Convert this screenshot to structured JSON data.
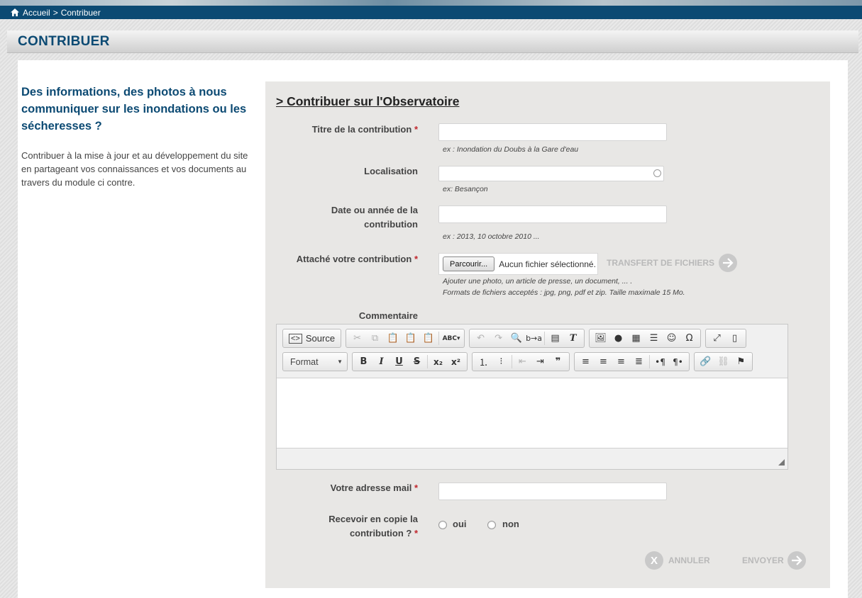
{
  "breadcrumb": {
    "home": "Accueil",
    "separator": ">",
    "current": "Contribuer"
  },
  "page": {
    "title": "CONTRIBUER"
  },
  "intro": {
    "heading": "Des informations, des photos à nous communiquer sur les inondations ou les sécheresses ?",
    "text": "Contribuer à la mise à jour et au développement du site en partageant vos connaissances et vos documents au travers du module ci contre."
  },
  "form": {
    "title": "> Contribuer sur l'Observatoire",
    "required_mark": "*",
    "titre": {
      "label": "Titre de la contribution",
      "value": "",
      "hint": "ex : Inondation du Doubs à la Gare d'eau"
    },
    "localisation": {
      "label": "Localisation",
      "value": "",
      "hint": "ex: Besançon"
    },
    "date": {
      "label": "Date ou année de la contribution",
      "value": "",
      "hint": "ex : 2013, 10 octobre 2010 ..."
    },
    "attachment": {
      "label": "Attaché votre contribution",
      "browse_label": "Parcourir...",
      "status": "Aucun fichier sélectionné.",
      "transfer_label": "TRANSFERT DE FICHIERS",
      "hint_line1": "Ajouter une photo, un article de presse, un document, ... .",
      "hint_line2": "Formats de fichiers acceptés : jpg, png, pdf et zip. Taille maximale 15 Mo."
    },
    "comment": {
      "label": "Commentaire",
      "source_label": "Source",
      "format_label": "Format",
      "spellcheck_label": "ABC"
    },
    "email": {
      "label": "Votre adresse mail",
      "value": ""
    },
    "copy": {
      "label": "Recevoir en copie la contribution ?",
      "yes": "oui",
      "no": "non"
    },
    "cancel_label": "ANNULER",
    "submit_label": "ENVOYER"
  }
}
